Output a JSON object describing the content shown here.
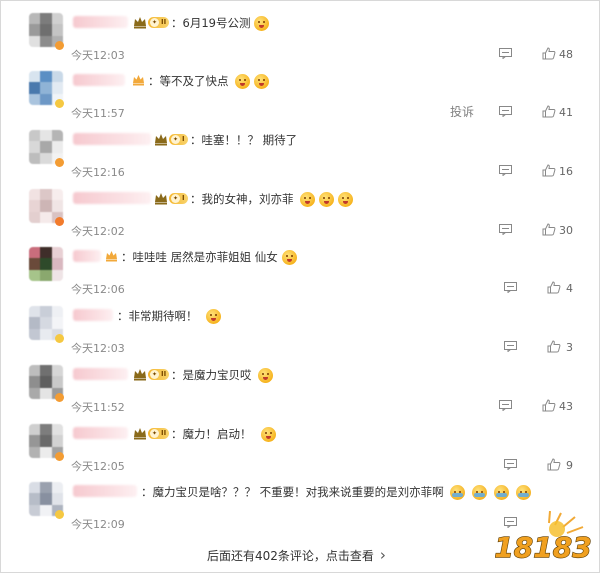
{
  "comments": [
    {
      "text": "：6月19号公测",
      "emojis": 1,
      "time": "今天12:03",
      "likes": "48",
      "vip": "big",
      "level": "II",
      "report": ""
    },
    {
      "text": "：等不及了快点",
      "emojis": 2,
      "time": "今天11:57",
      "likes": "41",
      "vip": "small",
      "level": "",
      "report": "投诉"
    },
    {
      "text": "：哇塞！！？ 期待了",
      "emojis": 0,
      "time": "今天12:16",
      "likes": "16",
      "vip": "big",
      "level": "I",
      "report": ""
    },
    {
      "text": "：我的女神，刘亦菲",
      "emojis": 3,
      "time": "今天12:02",
      "likes": "30",
      "vip": "big",
      "level": "I",
      "report": ""
    },
    {
      "text": "：哇哇哇 居然是亦菲姐姐 仙女",
      "emojis": 1,
      "time": "今天12:06",
      "likes": "4",
      "vip": "small",
      "level": "",
      "report": ""
    },
    {
      "text": "：非常期待啊！",
      "emojis": 1,
      "time": "今天12:03",
      "likes": "3",
      "vip": "none",
      "level": "",
      "report": ""
    },
    {
      "text": "：是魔力宝贝哎",
      "emojis": 1,
      "time": "今天11:52",
      "likes": "43",
      "vip": "big",
      "level": "II",
      "report": ""
    },
    {
      "text": "：魔力！启动！",
      "emojis": 1,
      "time": "今天12:05",
      "likes": "9",
      "vip": "big",
      "level": "II",
      "report": ""
    },
    {
      "text": "：魔力宝贝是啥？？？ 不重要！对我来说重要的是刘亦菲啊",
      "emojis": 4,
      "time": "今天12:09",
      "likes": "",
      "vip": "none",
      "level": "",
      "report": ""
    }
  ],
  "footer": {
    "more_text": "后面还有402条评论，点击查看",
    "more_arrow": "›"
  },
  "watermark": {
    "text": "18183"
  },
  "icons": {
    "reply": "comment-icon",
    "like": "thumbs-up-icon",
    "crown": "crown-icon",
    "emoji": "emoji-face-icon"
  },
  "colors": {
    "vip_gold": "#f5b833",
    "text": "#333333",
    "meta": "#8a8a8a",
    "logo_orange": "#f0a020"
  }
}
